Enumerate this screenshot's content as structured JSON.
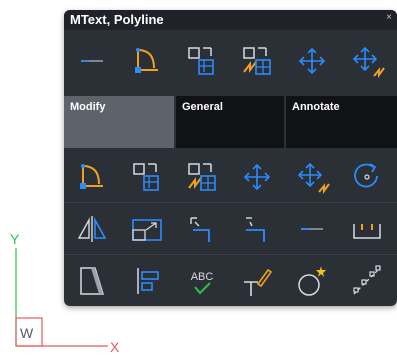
{
  "panel": {
    "title": "MText, Polyline",
    "close_glyph": "×"
  },
  "tabs": [
    {
      "label": "Modify",
      "active": true
    },
    {
      "label": "General",
      "active": false
    },
    {
      "label": "Annotate",
      "active": false
    }
  ],
  "grid": {
    "abc_text": "ABC"
  },
  "ucs": {
    "y_label": "Y",
    "x_label": "X",
    "w_label": "W"
  },
  "colors": {
    "accent_blue": "#2a8cff",
    "accent_orange": "#f0a020",
    "ucs_green": "#2fbf4a",
    "ucs_red": "#e85a5a"
  }
}
